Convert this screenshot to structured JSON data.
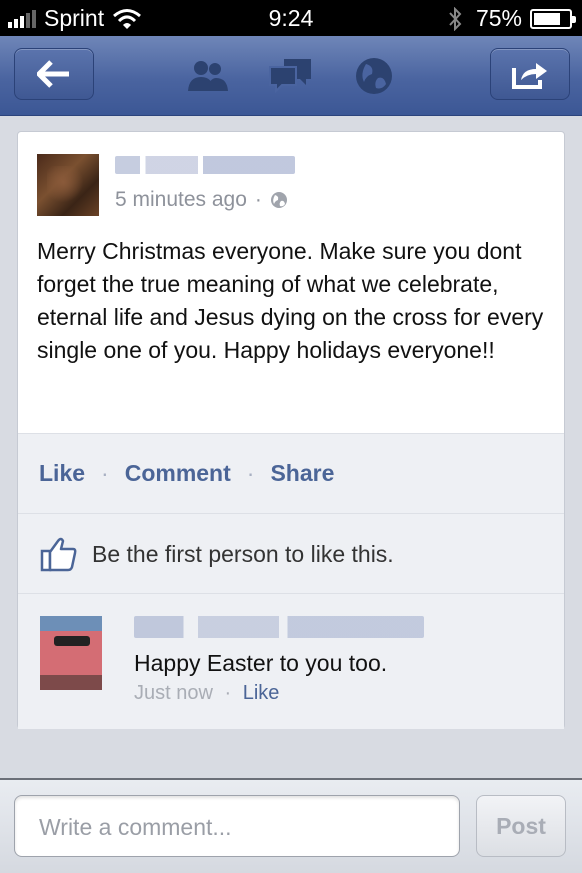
{
  "status_bar": {
    "carrier": "Sprint",
    "time": "9:24",
    "battery": "75%",
    "battery_level": 0.75
  },
  "nav": {
    "back_icon": "arrow-left-icon",
    "icons": [
      "friends-icon",
      "messages-icon",
      "globe-icon"
    ],
    "share_icon": "share-icon"
  },
  "post": {
    "timestamp": "5 minutes ago",
    "separator": "·",
    "text": "Merry Christmas everyone. Make sure you dont forget the true meaning of what we celebrate, eternal life and Jesus dying on the cross for every single one of you. Happy holidays everyone!!"
  },
  "actions": {
    "like": "Like",
    "comment": "Comment",
    "share": "Share",
    "separator": "·"
  },
  "likes_text": "Be the first person to like this.",
  "comment": {
    "text": "Happy Easter to you too.",
    "time": "Just now",
    "separator": "·",
    "like": "Like"
  },
  "compose": {
    "placeholder": "Write a comment...",
    "post_label": "Post"
  },
  "colors": {
    "brand": "#3c5795",
    "link": "#4b6597"
  }
}
